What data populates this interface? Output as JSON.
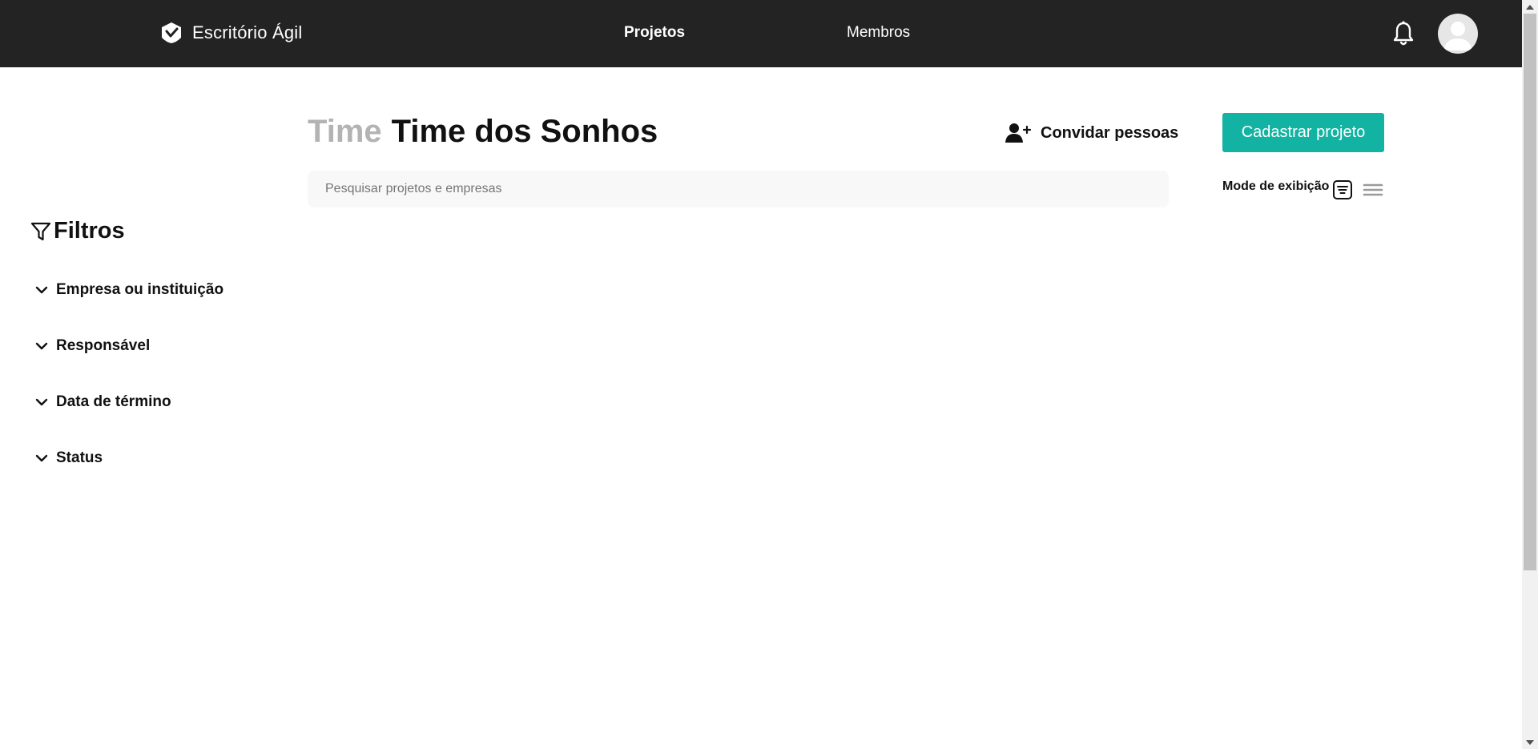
{
  "header": {
    "brand": "Escritório Ágil",
    "nav": {
      "projects": "Projetos",
      "members": "Membros"
    },
    "icons": {
      "logo": "shield-check-logo",
      "notifications": "bell-icon",
      "profile": "user-avatar"
    }
  },
  "sidebar": {
    "title": "Filtros",
    "title_icon": "funnel-icon",
    "filters": [
      {
        "label": "Empresa ou instituição"
      },
      {
        "label": "Responsável"
      },
      {
        "label": "Data de término"
      },
      {
        "label": "Status"
      }
    ]
  },
  "main": {
    "title_prefix": "Time",
    "team_name": "Time dos Sonhos",
    "invite_label": "Convidar pessoas",
    "invite_icon": "user-plus-icon",
    "create_project_label": "Cadastrar projeto",
    "search": {
      "value": "",
      "placeholder": "Pesquisar projetos e empresas"
    },
    "view_mode": {
      "label": "Mode de exibição",
      "options": [
        "card-view-icon",
        "list-view-icon"
      ]
    }
  },
  "colors": {
    "topbar": "#232323",
    "accent": "#12b3a2",
    "title_prefix": "#b3b3b3"
  }
}
